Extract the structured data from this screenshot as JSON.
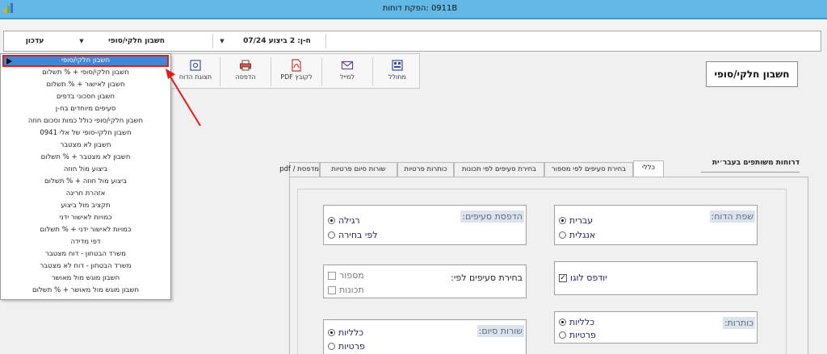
{
  "window": {
    "title": "0911B :הפקת דוחות"
  },
  "filters": {
    "update": "עדכון",
    "report_type": "חשבון חלקי/סופי",
    "period": "ח-ן: 2 ביצוע 07/24"
  },
  "toolbar": [
    {
      "name": "mixer",
      "label": "מחולל",
      "icon": "generator-icon"
    },
    {
      "name": "email",
      "label": "למייל",
      "icon": "mail-icon"
    },
    {
      "name": "pdf",
      "label": "PDF לקובץ",
      "icon": "pdf-icon"
    },
    {
      "name": "print",
      "label": "הדפסה",
      "icon": "printer-icon"
    },
    {
      "name": "preview",
      "label": "תצוגת הדוח",
      "icon": "preview-icon"
    }
  ],
  "page_title": "חשבון חלקי/סופי",
  "dropdown": {
    "items": [
      "חשבון חלקי/סופי",
      "חשבון חלקי/סופי + % תשלום",
      "חשבון לאישור + % תשלום",
      "חשבון חסכוני בדפים",
      "סעיפים מיוחדים בח-ן",
      "חשבון חלקי/סופי כולל כמות וסכום חוזה",
      "חשבון חלקי-סופי של אלי 0941",
      "חשבון לא מצטבר",
      "חשבון לא מצטבר + % תשלום",
      "ביצוע מול חוזה",
      "ביצוע מול חוזה + % תשלום",
      "אזהרת חריגה",
      "תקציב מול ביצוע",
      "כמויות לאישור ידני",
      "כמויות לאישור ידני + % תשלום",
      "דפי מדידה",
      "משרד הבטחון - דוח מצטבר",
      "משרד הבטחון - דוח לא מצטבר",
      "חשבון מוגש מול מאושר",
      "חשבון מוגש מול מאושר + % תשלום"
    ],
    "selected_index": 0
  },
  "tabs": {
    "section_label": "דרוחות משותפים בעבר׳ית",
    "items": [
      "כללי",
      "בחירת סעיפים לפי מספור",
      "בחירת סעיפים לפי תכונות",
      "כותרות פרטיות",
      "שורות סיום פרטיות",
      "מדפסת / pdf"
    ],
    "active_index": 0
  },
  "general": {
    "language": {
      "label": "שפת הדוח:",
      "options": [
        "עברית",
        "אנגלית"
      ],
      "selected": 0
    },
    "printing": {
      "label": "הדפסת סעיפים:",
      "options": [
        "רגילה",
        "לפי בחירה"
      ],
      "selected": 0
    },
    "logo": {
      "label": "יודפס לוגו",
      "checked": true
    },
    "selection": {
      "label": "בחירת סעיפים לפי:",
      "options": [
        "מספור",
        "תכונות"
      ]
    },
    "headers": {
      "label": "כותרות:",
      "options": [
        "כלליות",
        "פרטיות"
      ],
      "selected": 0
    },
    "footer": {
      "label": "שורות סיום:",
      "options": [
        "כלליות",
        "פרטיות"
      ],
      "selected": 0
    }
  },
  "colors": {
    "titlebar": "#63b8e6",
    "selection": "#3d86d8",
    "highlight": "#e31b1b",
    "option_text": "#22226a"
  }
}
